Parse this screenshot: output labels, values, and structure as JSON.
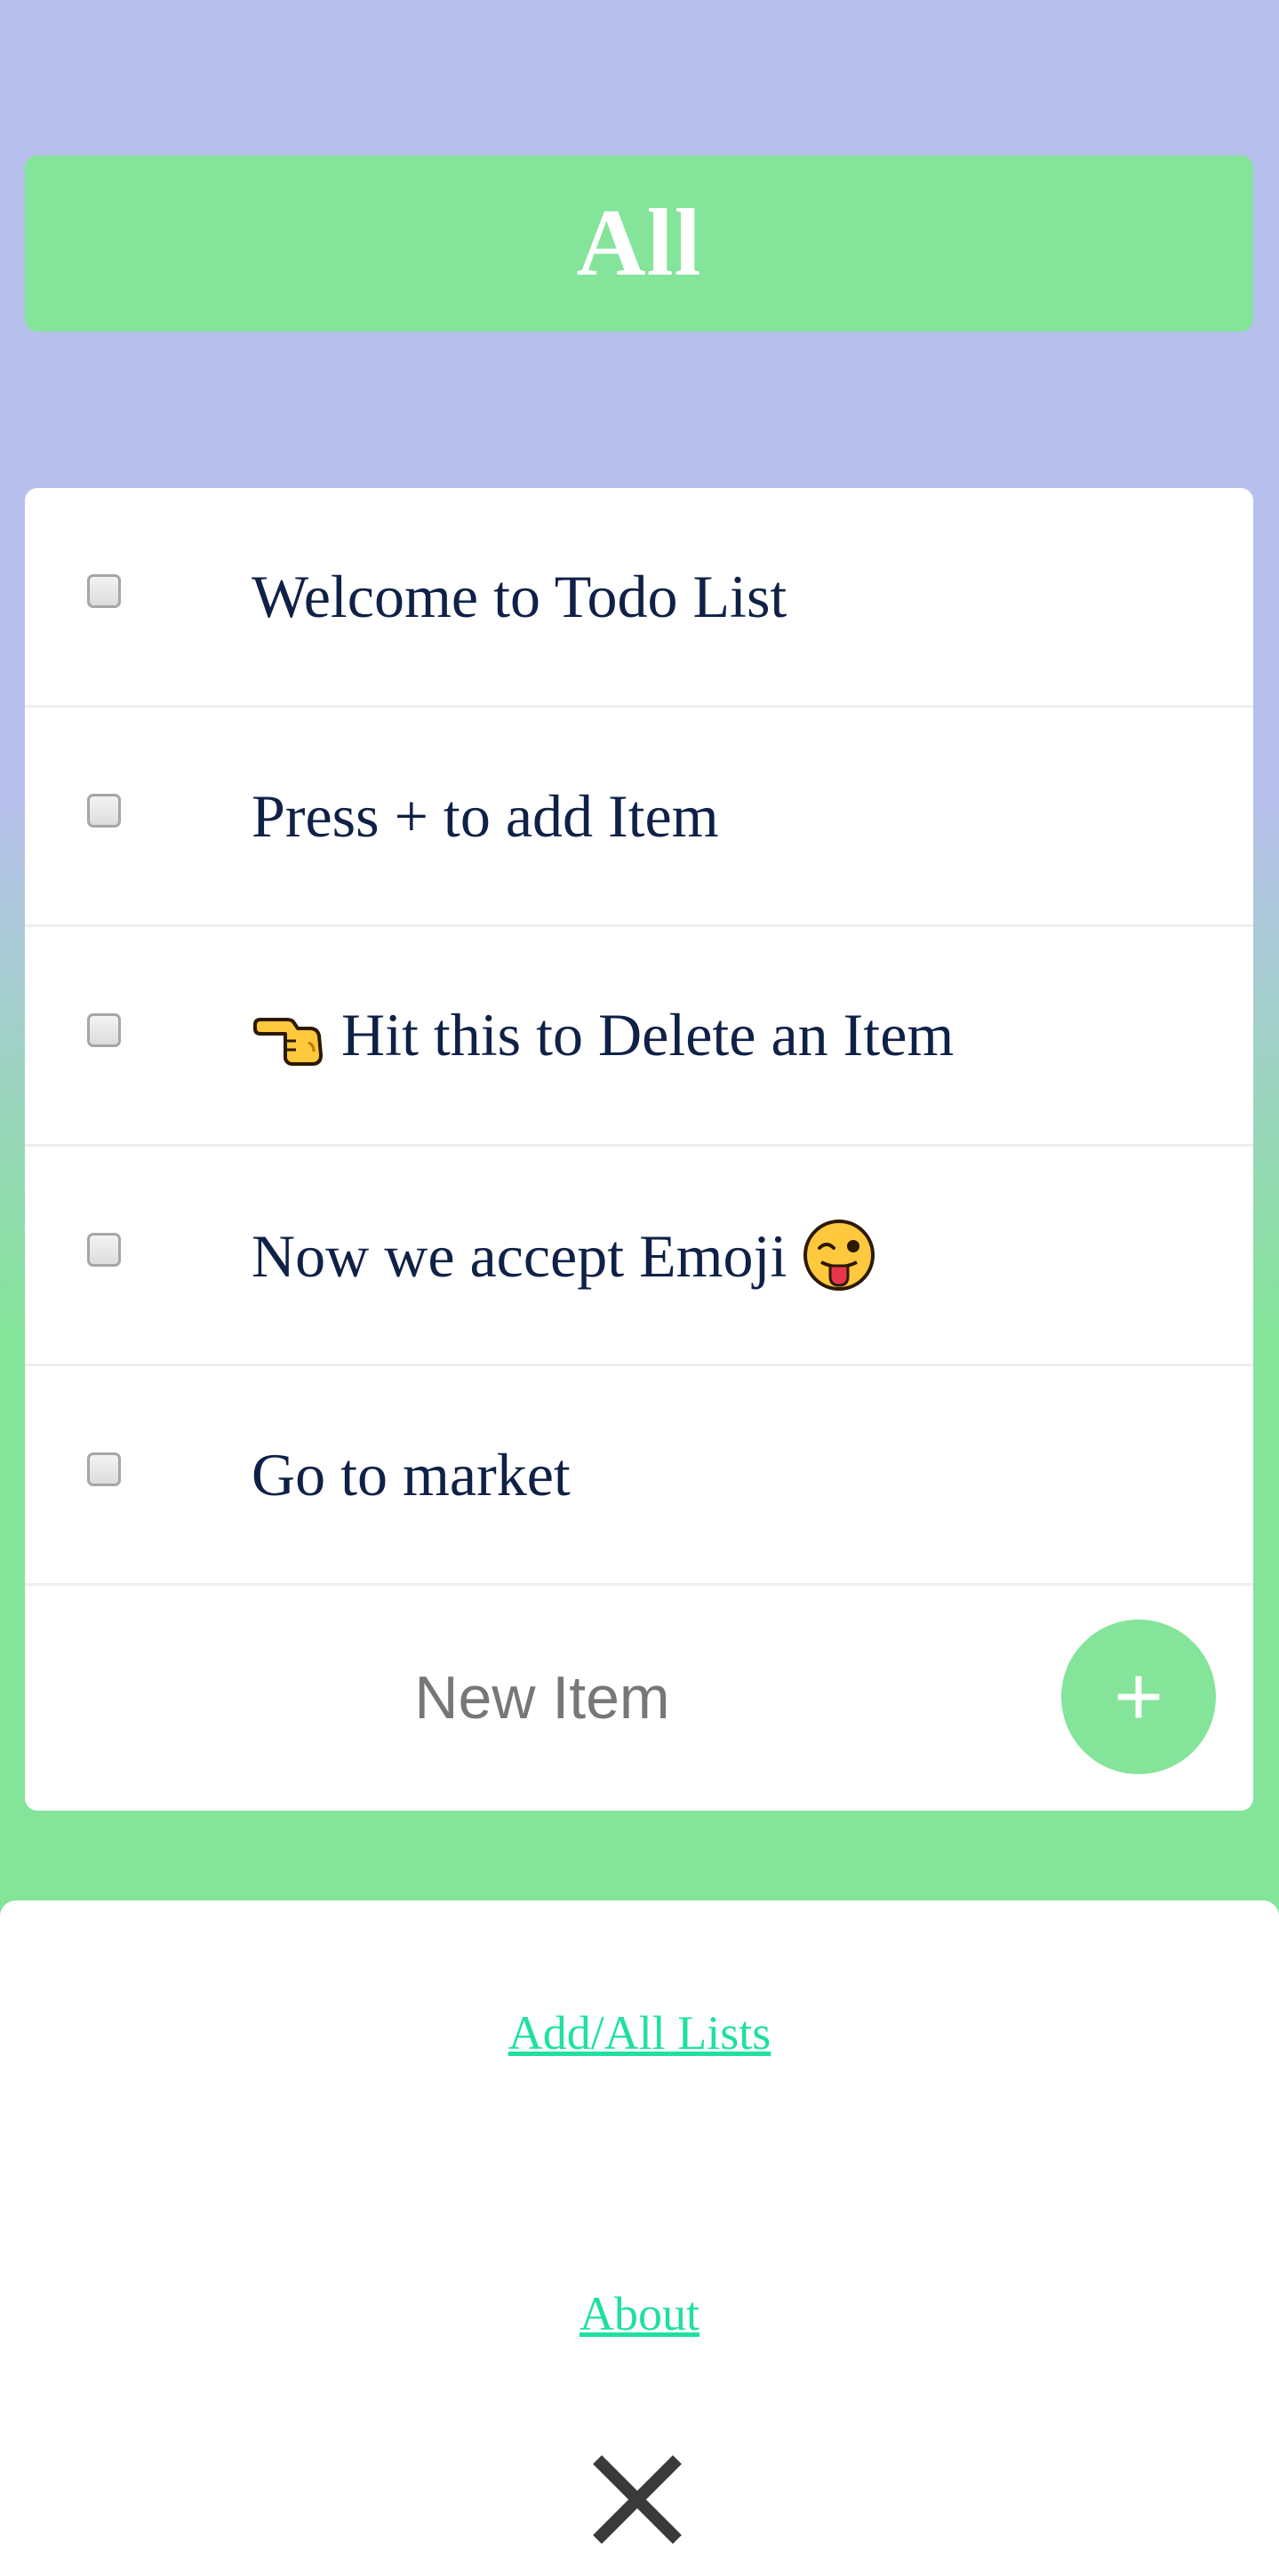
{
  "header": {
    "title": "All"
  },
  "todos": [
    {
      "text": "Welcome to Todo List",
      "checked": false
    },
    {
      "text": "Press + to add Item",
      "checked": false
    },
    {
      "text": "Hit this to Delete an Item",
      "emoji_prefix": "backhand-index-pointing-left-icon",
      "checked": false
    },
    {
      "text": "Now we accept Emoji",
      "emoji_suffix": "winking-face-with-tongue-icon",
      "checked": false
    },
    {
      "text": "Go to market",
      "checked": false
    }
  ],
  "new_item": {
    "placeholder": "New Item",
    "add_label": "+"
  },
  "footer": {
    "links": [
      "Add/All Lists",
      "About"
    ],
    "close_label": "close"
  },
  "colors": {
    "accent_green": "#84e499",
    "background_top": "#b7c0ec",
    "text_dark": "#0f2147",
    "link_color": "#1fe0a0"
  }
}
